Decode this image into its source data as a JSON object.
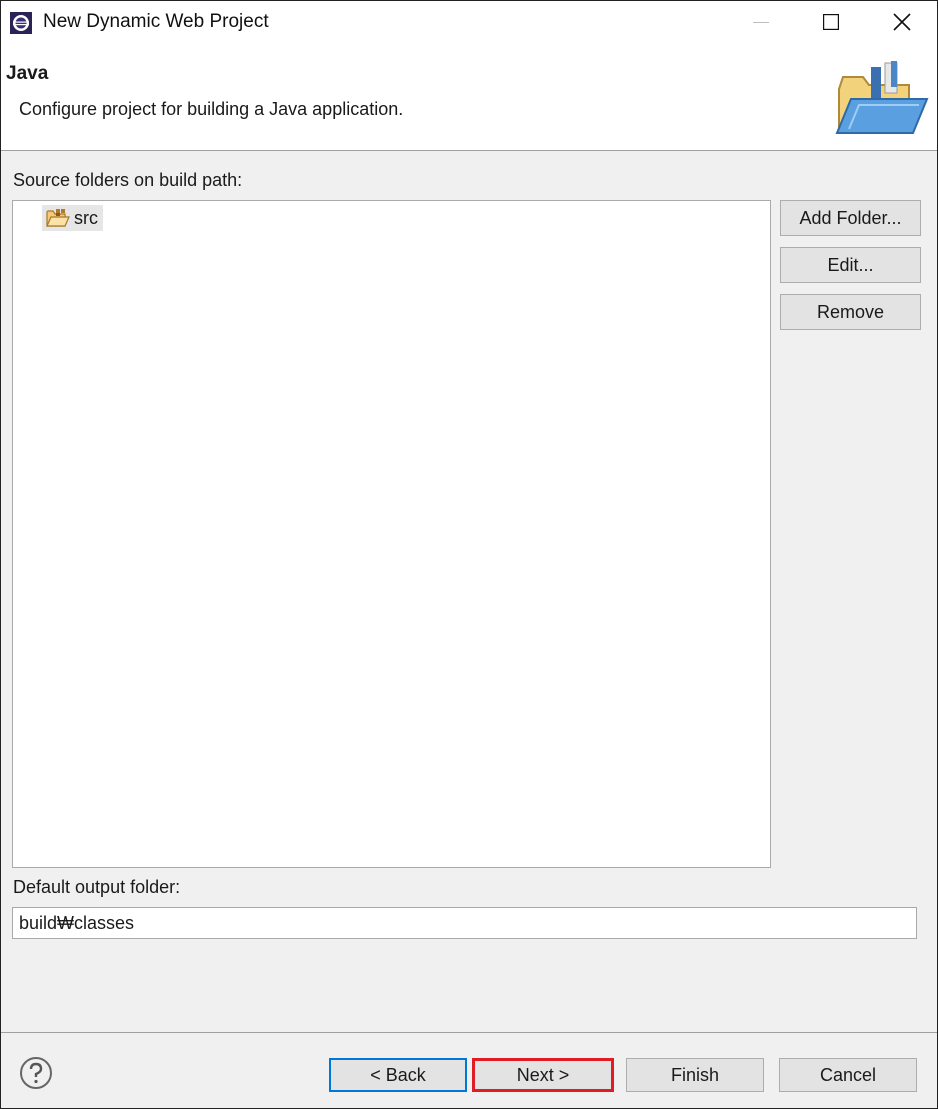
{
  "window": {
    "title": "New Dynamic Web Project"
  },
  "header": {
    "title": "Java",
    "description": "Configure project for building a Java application."
  },
  "source": {
    "label": "Source folders on build path:",
    "folders": [
      {
        "name": "src"
      }
    ],
    "buttons": {
      "add": "Add Folder...",
      "edit": "Edit...",
      "remove": "Remove"
    }
  },
  "output": {
    "label": "Default output folder:",
    "value": "build₩classes"
  },
  "footer": {
    "back": "< Back",
    "next": "Next >",
    "finish": "Finish",
    "cancel": "Cancel"
  },
  "colors": {
    "back_focus_border": "#0078d7",
    "next_highlight_border": "#e21c24"
  }
}
